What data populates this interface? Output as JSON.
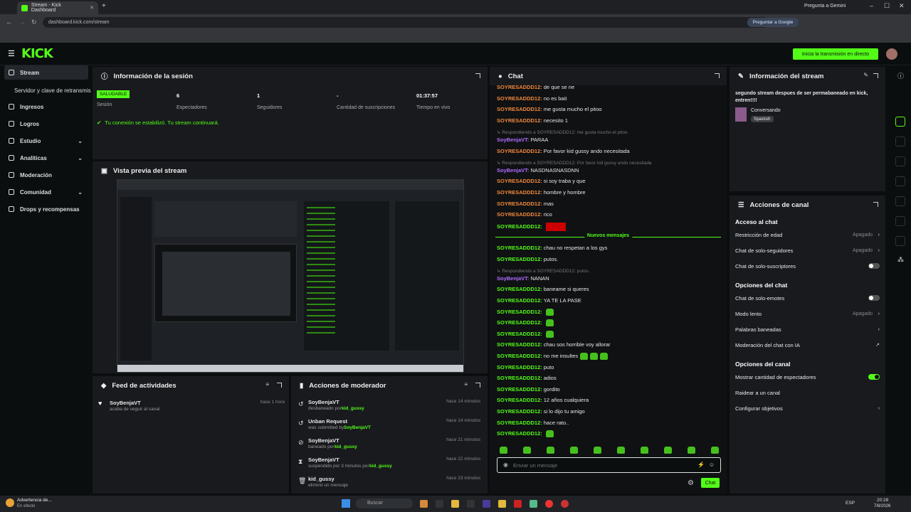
{
  "browser": {
    "tab_title": "Stream - Kick Dashboard",
    "url": "dashboard.kick.com/stream",
    "gemini": "Pregunta a Gemini",
    "google_btn": "Preguntar a Google"
  },
  "header": {
    "logo": "KICK",
    "live_button": "Inicia la transmisión en directo"
  },
  "sidebar": {
    "items": [
      {
        "label": "Stream"
      },
      {
        "label": "Servidor y clave de retransmisión"
      },
      {
        "label": "Ingresos"
      },
      {
        "label": "Logros"
      },
      {
        "label": "Estudio"
      },
      {
        "label": "Analíticas"
      },
      {
        "label": "Moderación"
      },
      {
        "label": "Comunidad"
      },
      {
        "label": "Drops y recompensas"
      }
    ]
  },
  "session": {
    "title": "Información de la sesión",
    "health": "SALUDABLE",
    "health_label": "Sesión",
    "stats": [
      {
        "value": "6",
        "label": "Espectadores"
      },
      {
        "value": "1",
        "label": "Seguidores"
      },
      {
        "value": "-",
        "label": "Cantidad de suscripciones"
      },
      {
        "value": "01:37:57",
        "label": "Tiempo en vivo"
      }
    ],
    "status": "Tu conexión se estabilizó. Tu stream continuará."
  },
  "preview": {
    "title": "Vista previa del stream"
  },
  "feed": {
    "title": "Feed de actividades",
    "items": [
      {
        "user": "SoyBenjaVT",
        "action": "acaba de seguir al canal",
        "time": "hace 1 hora"
      }
    ]
  },
  "mod": {
    "title": "Acciones de moderador",
    "items": [
      {
        "title": "SoyBenjaVT",
        "pre": "desbaneado por ",
        "by": "kid_gussy",
        "time": "hace 14 minutos"
      },
      {
        "title": "Unban Request",
        "pre": "was submitted by ",
        "by": "SoyBenjaVT",
        "time": "hace 14 minutos"
      },
      {
        "title": "SoyBenjaVT",
        "pre": "baneado por ",
        "by": "kid_gussy",
        "time": "hace 21 minutos"
      },
      {
        "title": "SoyBenjaVT",
        "pre": "suspendido por 3 minutos por ",
        "by": "kid_gussy",
        "time": "hace 22 minutos"
      },
      {
        "title": "kid_gussy",
        "pre": "eliminó un mensaje",
        "by": "",
        "time": "hace 23 minutos"
      }
    ]
  },
  "chat": {
    "title": "Chat",
    "new_messages": "Nuevos mensajes",
    "placeholder": "Enviar un mensaje",
    "send": "Chat",
    "messages": [
      {
        "user": "SOYRESADDD12:",
        "text": "de que se rie",
        "color": "#f1883c"
      },
      {
        "user": "SOYRESADDD12:",
        "text": "no es bait",
        "color": "#f1883c"
      },
      {
        "user": "SOYRESADDD12:",
        "text": "me gusta mucho el pitoo",
        "color": "#f1883c"
      },
      {
        "user": "SOYRESADDD12:",
        "text": "necesito 1",
        "color": "#f1883c"
      },
      {
        "reply": "Respondiendo a SOYRESADDD12: me gusta mucho el pitoo"
      },
      {
        "user": "SoyBenjaVT:",
        "text": "PARAA",
        "color": "#b06bff"
      },
      {
        "user": "SOYRESADDD12:",
        "text": "Por favor kid gussy ando necesitada",
        "color": "#f1883c"
      },
      {
        "reply": "Respondiendo a SOYRESADDD12: Por favor kid gussy ando necesitada"
      },
      {
        "user": "SoyBenjaVT:",
        "text": "NASDNASNASDNN",
        "color": "#b06bff"
      },
      {
        "user": "SOYRESADDD12:",
        "text": "si soy traba y que",
        "color": "#f1883c"
      },
      {
        "user": "SOYRESADDD12:",
        "text": "hombre y hombre",
        "color": "#f1883c"
      },
      {
        "user": "SOYRESADDD12:",
        "text": "mas",
        "color": "#f1883c"
      },
      {
        "user": "SOYRESADDD12:",
        "text": "rico",
        "color": "#f1883c"
      },
      {
        "user": "SOYRESADDD12:",
        "text": "",
        "color": "#53fc18",
        "redact": true
      },
      {
        "divider": true
      },
      {
        "user": "SOYRESADDD12:",
        "text": "chau no respetan a los gys",
        "color": "#53fc18"
      },
      {
        "user": "SOYRESADDD12:",
        "text": "putos.",
        "color": "#53fc18"
      },
      {
        "reply": "Respondiendo a SOYRESADDD12: putos."
      },
      {
        "user": "SoyBenjaVT:",
        "text": "NANAN",
        "color": "#b06bff"
      },
      {
        "user": "SOYRESADDD12:",
        "text": "baneame si queres",
        "color": "#53fc18"
      },
      {
        "user": "SOYRESADDD12:",
        "text": "YA TE LA PASE",
        "color": "#53fc18"
      },
      {
        "user": "SOYRESADDD12:",
        "text": "",
        "color": "#53fc18",
        "emotes": 1
      },
      {
        "user": "SOYRESADDD12:",
        "text": "",
        "color": "#53fc18",
        "emotes": 1
      },
      {
        "user": "SOYRESADDD12:",
        "text": "",
        "color": "#53fc18",
        "emotes": 1
      },
      {
        "user": "SOYRESADDD12:",
        "text": "chau sos horrible voy allorar",
        "color": "#53fc18"
      },
      {
        "user": "SOYRESADDD12:",
        "text": "no me insultes",
        "color": "#53fc18",
        "emotes": 3
      },
      {
        "user": "SOYRESADDD12:",
        "text": "puto",
        "color": "#53fc18"
      },
      {
        "user": "SOYRESADDD12:",
        "text": "adios",
        "color": "#53fc18"
      },
      {
        "user": "SOYRESADDD12:",
        "text": "gordito",
        "color": "#53fc18"
      },
      {
        "user": "SOYRESADDD12:",
        "text": "12 años cualquiera",
        "color": "#53fc18"
      },
      {
        "user": "SOYRESADDD12:",
        "text": "si lo dijo tu amigo",
        "color": "#53fc18"
      },
      {
        "user": "SOYRESADDD12:",
        "text": "hace rato..",
        "color": "#53fc18"
      },
      {
        "user": "SOYRESADDD12:",
        "text": "",
        "color": "#53fc18",
        "emotes": 1
      },
      {
        "user": "SOYRESADDD12:",
        "text": "",
        "color": "#53fc18",
        "emotes": 1
      }
    ]
  },
  "streaminfo": {
    "title": "Información del stream",
    "description": "segundo stream despues de ser permabaneado en kick, entren!!!!",
    "category": "Conversando",
    "language": "Spanish"
  },
  "channel": {
    "title": "Acciones de canal",
    "sections": [
      {
        "header": "Acceso al chat",
        "rows": [
          {
            "label": "Restricción de edad",
            "value": "Apagado",
            "kind": "chevron"
          },
          {
            "label": "Chat de solo-seguidores",
            "value": "Apagado",
            "kind": "chevron"
          },
          {
            "label": "Chat de solo-suscriptores",
            "value": "",
            "kind": "toggle"
          }
        ]
      },
      {
        "header": "Opciones del chat",
        "rows": [
          {
            "label": "Chat de solo-emotes",
            "value": "",
            "kind": "toggle"
          },
          {
            "label": "Modo lento",
            "value": "Apagado",
            "kind": "chevron"
          },
          {
            "label": "Palabras baneadas",
            "value": "",
            "kind": "chevron"
          },
          {
            "label": "Moderación del chat con IA",
            "value": "",
            "kind": "link"
          }
        ]
      },
      {
        "header": "Opciones del canal",
        "rows": [
          {
            "label": "Mostrar cantidad de espectadores",
            "value": "",
            "kind": "toggle-on"
          },
          {
            "label": "Raidear a un canal",
            "value": "",
            "kind": "none"
          },
          {
            "label": "Configurar objetivos",
            "value": "",
            "kind": "chevron"
          }
        ]
      }
    ]
  },
  "taskbar": {
    "notice_title": "Advertencia de...",
    "notice_sub": "En efecto",
    "search": "Buscar",
    "lang": "ESP",
    "time": "20:28",
    "date": "7/8/2026"
  }
}
